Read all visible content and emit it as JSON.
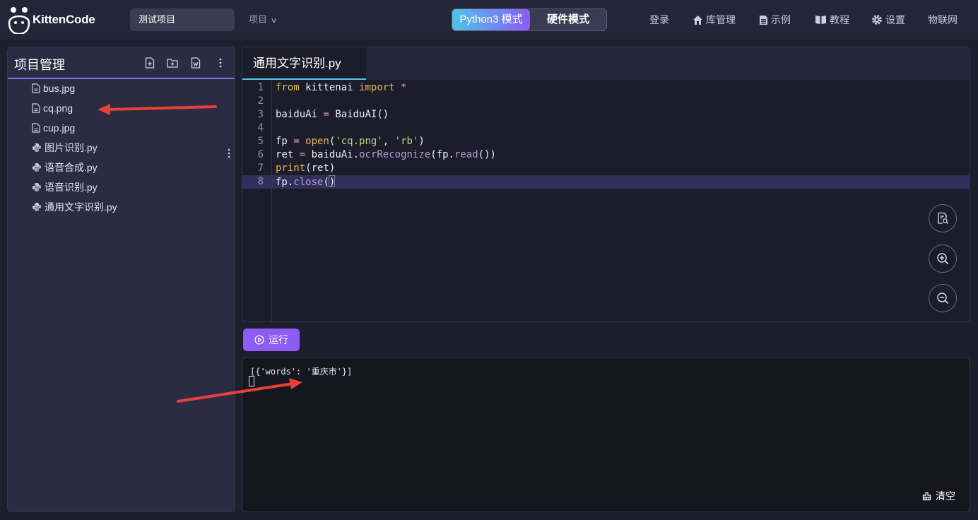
{
  "header": {
    "logo_text": "KittenCode",
    "project_name": "测试项目",
    "project_menu": "项目",
    "modes": {
      "python": "Python3 模式",
      "hardware": "硬件模式",
      "active": "python"
    },
    "nav": [
      {
        "label": "登录",
        "icon": ""
      },
      {
        "label": "库管理",
        "icon": "home-icon"
      },
      {
        "label": "示例",
        "icon": "document-icon"
      },
      {
        "label": "教程",
        "icon": "book-icon"
      },
      {
        "label": "设置",
        "icon": "gear-icon"
      },
      {
        "label": "物联网",
        "icon": ""
      }
    ]
  },
  "sidebar": {
    "title": "项目管理",
    "tools": [
      "new-file-icon",
      "new-folder-icon",
      "upload-file-icon",
      "more-vertical-icon"
    ],
    "files": [
      {
        "name": "bus.jpg",
        "icon": "file-icon"
      },
      {
        "name": "cq.png",
        "icon": "file-icon",
        "hovered": true
      },
      {
        "name": "cup.jpg",
        "icon": "file-icon"
      },
      {
        "name": "图片识别.py",
        "icon": "python-icon"
      },
      {
        "name": "语音合成.py",
        "icon": "python-icon"
      },
      {
        "name": "语音识别.py",
        "icon": "python-icon"
      },
      {
        "name": "通用文字识别.py",
        "icon": "python-icon"
      }
    ]
  },
  "editor": {
    "tab": "通用文字识别.py",
    "active_line": 8,
    "lines": [
      "from kittenai import *",
      "",
      "baiduAi = BaiduAI()",
      "",
      "fp = open('cq.png', 'rb')",
      "ret = baiduAi.ocrRecognize(fp.read())",
      "print(ret)",
      "fp.close()"
    ],
    "side_buttons": [
      "search-document-icon",
      "zoom-in-icon",
      "zoom-out-icon"
    ]
  },
  "run": {
    "label": "运行",
    "icon": "play-icon"
  },
  "console": {
    "output": "[{'words': '重庆市'}]",
    "clear_label": "清空"
  },
  "colors": {
    "accent_purple": "#8b5cf6",
    "accent_cyan": "#4fc4e8",
    "annotation_red": "#e8413a"
  }
}
